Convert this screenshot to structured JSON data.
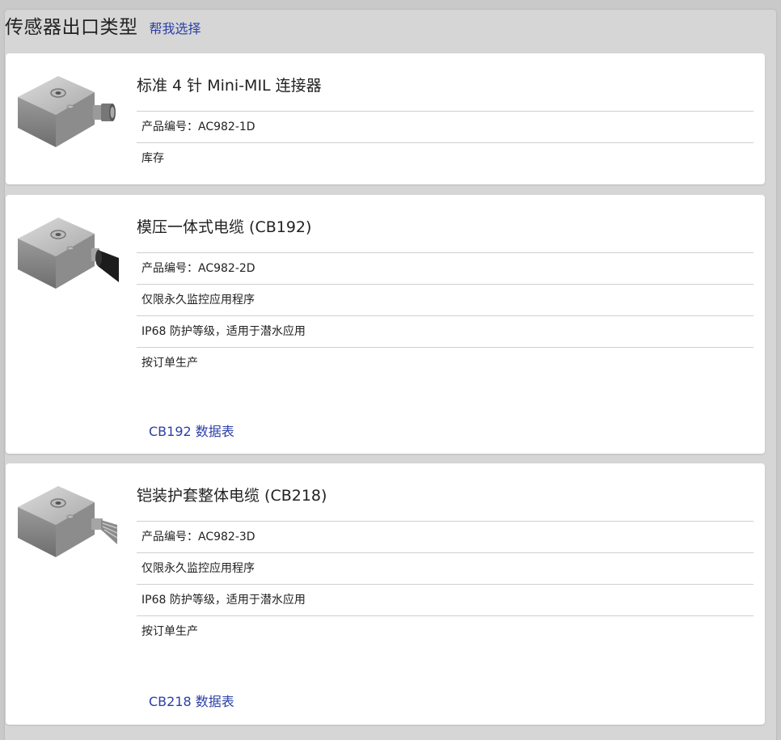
{
  "header": {
    "title": "传感器出口类型",
    "help_link": "帮我选择"
  },
  "products": [
    {
      "name": "标准 4 针 Mini-MIL 连接器",
      "rows": [
        "产品编号：AC982-1D",
        "库存"
      ],
      "datasheet": null,
      "image_icon": "sensor-connector-icon"
    },
    {
      "name": "模压一体式电缆 (CB192)",
      "rows": [
        "产品编号：AC982-2D",
        "仅限永久监控应用程序",
        "IP68 防护等级，适用于潜水应用",
        "按订单生产"
      ],
      "datasheet": "CB192 数据表",
      "image_icon": "sensor-molded-cable-icon"
    },
    {
      "name": "铠装护套整体电缆 (CB218)",
      "rows": [
        "产品编号：AC982-3D",
        "仅限永久监控应用程序",
        "IP68 防护等级，适用于潜水应用",
        "按订单生产"
      ],
      "datasheet": "CB218 数据表",
      "image_icon": "sensor-armored-cable-icon"
    }
  ],
  "colors": {
    "link": "#2a3fa8",
    "panel": "#d6d6d6",
    "card": "#ffffff",
    "divider": "#cfcfcf"
  }
}
